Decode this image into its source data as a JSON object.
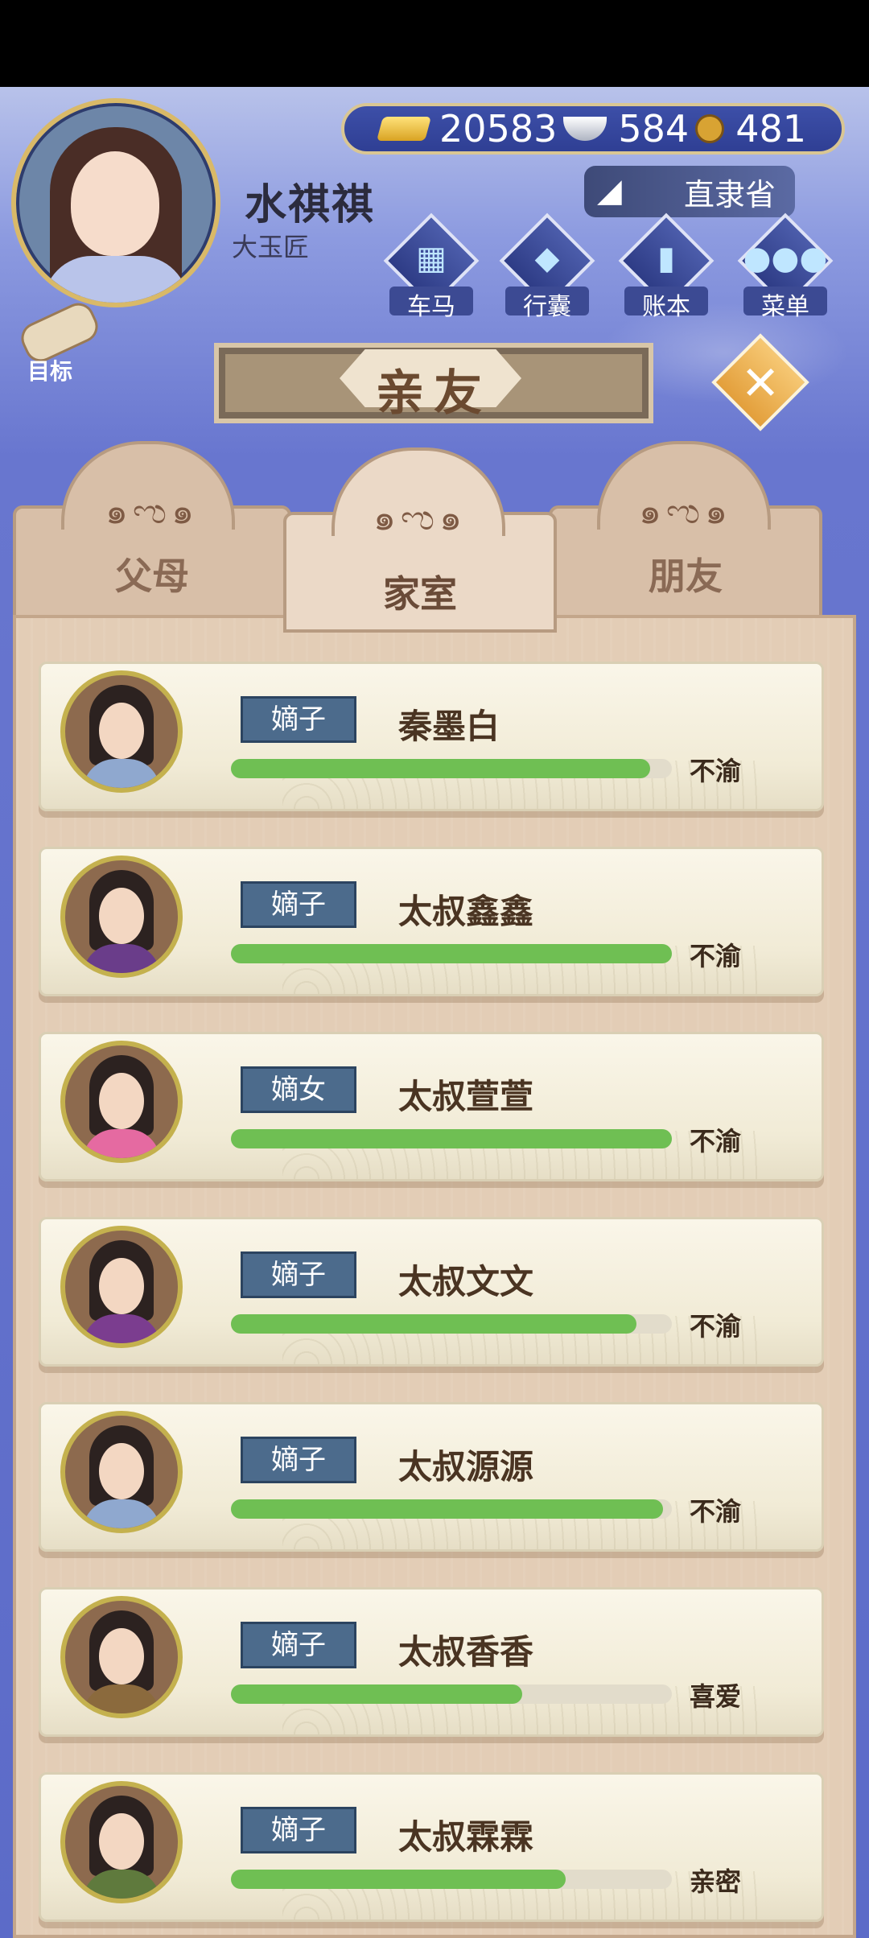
{
  "player": {
    "name": "水祺祺",
    "title": "大玉匠"
  },
  "currency": {
    "gold": "20583",
    "silver": "584",
    "copper": "481"
  },
  "location": "直隶省",
  "menu": [
    {
      "label": "车马",
      "icon": "carriage-icon"
    },
    {
      "label": "行囊",
      "icon": "bag-icon"
    },
    {
      "label": "账本",
      "icon": "ledger-icon"
    },
    {
      "label": "菜单",
      "icon": "more-icon"
    }
  ],
  "goal": {
    "label": "目标"
  },
  "panel_title": "亲友",
  "tabs": [
    {
      "label": "父母",
      "active": false
    },
    {
      "label": "家室",
      "active": true
    },
    {
      "label": "朋友",
      "active": false
    }
  ],
  "relatives": [
    {
      "tag": "嫡子",
      "name": "秦墨白",
      "mood": "不渝",
      "affection": 0.95,
      "robe": "#8fa8cf"
    },
    {
      "tag": "嫡子",
      "name": "太叔鑫鑫",
      "mood": "不渝",
      "affection": 1.0,
      "robe": "#6a3d8a"
    },
    {
      "tag": "嫡女",
      "name": "太叔萱萱",
      "mood": "不渝",
      "affection": 1.0,
      "robe": "#e56aa1"
    },
    {
      "tag": "嫡子",
      "name": "太叔文文",
      "mood": "不渝",
      "affection": 0.92,
      "robe": "#7b3d8f"
    },
    {
      "tag": "嫡子",
      "name": "太叔源源",
      "mood": "不渝",
      "affection": 0.98,
      "robe": "#8fa8cf"
    },
    {
      "tag": "嫡子",
      "name": "太叔香香",
      "mood": "喜爱",
      "affection": 0.66,
      "robe": "#8b6a3d"
    },
    {
      "tag": "嫡子",
      "name": "太叔霖霖",
      "mood": "亲密",
      "affection": 0.76,
      "robe": "#5f7a3d"
    }
  ],
  "colors": {
    "accent": "#5c6bc8",
    "bar_fill": "#6fbf53",
    "tag_bg": "#4c6b8c"
  }
}
